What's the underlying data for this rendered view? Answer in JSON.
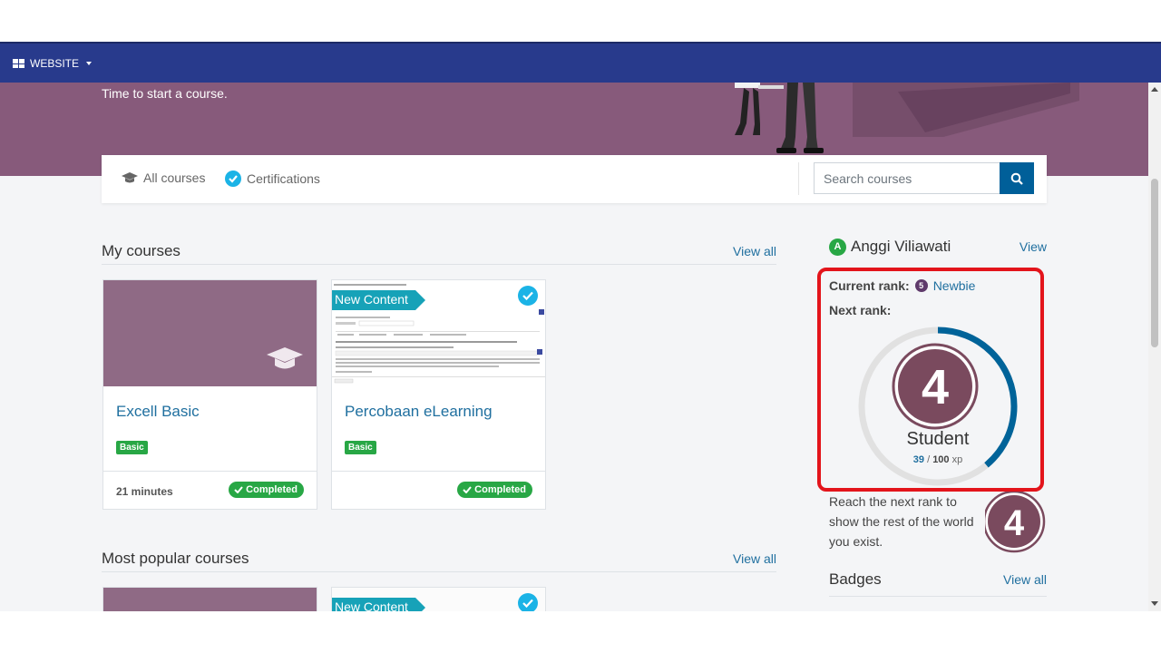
{
  "topbar": {
    "website_label": "WEBSITE"
  },
  "hero": {
    "subtitle": "Time to start a course."
  },
  "nav": {
    "all_courses": "All courses",
    "certifications": "Certifications",
    "search_placeholder": "Search courses"
  },
  "my_courses": {
    "title": "My courses",
    "view_all": "View all",
    "cards": [
      {
        "title": "Excell Basic",
        "tag": "Basic",
        "duration": "21 minutes",
        "status": "Completed"
      },
      {
        "title": "Percobaan eLearning",
        "tag": "Basic",
        "ribbon": "New Content",
        "status": "Completed"
      }
    ]
  },
  "popular_courses": {
    "title": "Most popular courses",
    "view_all": "View all",
    "cards": [
      {
        "ribbon": "New Content"
      }
    ]
  },
  "user": {
    "avatar_initial": "A",
    "name": "Anggi Viliawati",
    "view": "View",
    "current_rank_label": "Current rank:",
    "current_rank_number": "5",
    "current_rank": "Newbie",
    "next_rank_label": "Next rank:",
    "next_rank_number": "4",
    "next_rank": "Student",
    "xp_current": "39",
    "xp_separator": "/",
    "xp_max": "100",
    "xp_unit": "xp",
    "xp_progress": 0.39,
    "reach_text": "Reach the next rank to show the rest of the world you exist."
  },
  "badges": {
    "title": "Badges",
    "view_all": "View all"
  },
  "colors": {
    "topbar": "#283a8c",
    "hero": "#875a7b",
    "link": "#1f6f9f",
    "success": "#28a745",
    "highlight": "#e3141b",
    "rank_medal": "#7a4a5e",
    "progress": "#006399"
  },
  "icons": [
    "apps-grid-icon",
    "caret-down-icon",
    "graduation-cap-icon",
    "verified-check-icon",
    "search-icon",
    "check-icon",
    "rank-medal-icon"
  ]
}
